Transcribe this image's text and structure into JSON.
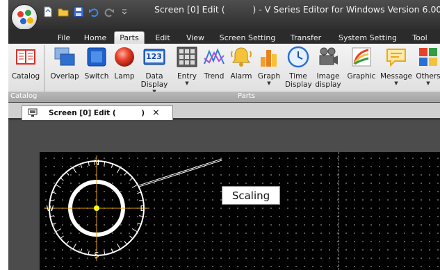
{
  "window": {
    "title": "Screen [0] Edit (          ) - V Series Editor for Windows Version 6.00"
  },
  "quick_access": [
    "new-icon",
    "open-icon",
    "save-icon",
    "undo-icon",
    "redo-icon",
    "dropdown-icon"
  ],
  "ribbon_tabs": [
    {
      "label": "File",
      "active": false
    },
    {
      "label": "Home",
      "active": false
    },
    {
      "label": "Parts",
      "active": true
    },
    {
      "label": "Edit",
      "active": false
    },
    {
      "label": "View",
      "active": false
    },
    {
      "label": "Screen Setting",
      "active": false
    },
    {
      "label": "Transfer",
      "active": false
    },
    {
      "label": "System Setting",
      "active": false
    },
    {
      "label": "Tool",
      "active": false
    }
  ],
  "ribbon": {
    "groups": {
      "catalog": "Catalog",
      "parts": "Parts"
    },
    "buttons": [
      {
        "label": "Catalog",
        "icon": "catalog-icon"
      },
      {
        "label": "Overlap",
        "icon": "overlap-icon"
      },
      {
        "label": "Switch",
        "icon": "switch-icon"
      },
      {
        "label": "Lamp",
        "icon": "lamp-icon"
      },
      {
        "label": "Data Display",
        "icon": "data-display-icon",
        "icon_text": "123"
      },
      {
        "label": "Entry",
        "icon": "entry-icon"
      },
      {
        "label": "Trend",
        "icon": "trend-icon"
      },
      {
        "label": "Alarm",
        "icon": "alarm-icon"
      },
      {
        "label": "Graph",
        "icon": "graph-icon"
      },
      {
        "label": "Time Display",
        "icon": "time-display-icon"
      },
      {
        "label": "Image display",
        "icon": "image-display-icon"
      },
      {
        "label": "Graphic",
        "icon": "graphic-icon"
      },
      {
        "label": "Message",
        "icon": "message-icon"
      },
      {
        "label": "Others",
        "icon": "others-icon"
      }
    ]
  },
  "document_tab": {
    "title": "Screen [0] Edit (          )",
    "close": "×",
    "icon": "monitor-icon"
  },
  "canvas": {
    "callout": "Scaling",
    "compass_labels": {
      "north": "N",
      "south": "S",
      "east": "E",
      "west": "W"
    }
  },
  "colors": {
    "canvas_bg": "#000000",
    "scale_ring": "#ffffff",
    "crosshair": "#e0a000",
    "center_dot": "#ffff00",
    "active_tab": "#e6e6e6"
  }
}
